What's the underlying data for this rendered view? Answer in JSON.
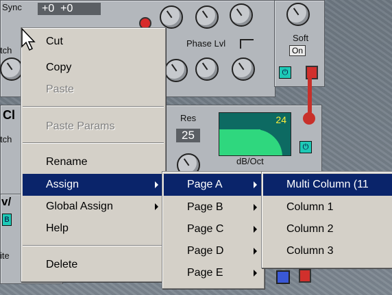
{
  "background_panel": {
    "sync_label": "Sync",
    "sync_values": "+0  +0",
    "phase_lvl_label": "Phase Lvl",
    "soft_label": "Soft",
    "soft_value": "On",
    "res_label": "Res",
    "res_value": "25",
    "filter_value": "24",
    "db_oct_label": "dB/Oct",
    "cl_label": "Cl",
    "ch_partial": "tch",
    "ch_partial2": "tch",
    "v_partial": "v/",
    "b_badge": "B",
    "ite_partial": "ite"
  },
  "context_menu": {
    "items": [
      {
        "label": "Cut",
        "enabled": true
      },
      {
        "label": "Copy",
        "enabled": true
      },
      {
        "label": "Paste",
        "enabled": false
      },
      {
        "label": "Paste Params",
        "enabled": false
      },
      {
        "label": "Rename",
        "enabled": true
      },
      {
        "label": "Assign",
        "enabled": true,
        "submenu": true,
        "selected": true
      },
      {
        "label": "Global Assign",
        "enabled": true,
        "submenu": true
      },
      {
        "label": "Help",
        "enabled": true
      },
      {
        "label": "Delete",
        "enabled": true
      }
    ]
  },
  "page_menu": {
    "items": [
      {
        "label": "Page A",
        "selected": true
      },
      {
        "label": "Page B"
      },
      {
        "label": "Page C"
      },
      {
        "label": "Page D"
      },
      {
        "label": "Page E"
      }
    ]
  },
  "column_menu": {
    "items": [
      {
        "label": "Multi Column (11",
        "selected": true
      },
      {
        "label": "Column 1"
      },
      {
        "label": "Column 2"
      },
      {
        "label": "Column 3"
      }
    ]
  },
  "colors": {
    "menu_bg": "#d4d0c8",
    "menu_selected": "#0a246a",
    "filter_green": "#2fd77e",
    "filter_dark": "#0d6a62",
    "power_teal": "#1ec9b6",
    "cable_red": "#c8302a"
  }
}
